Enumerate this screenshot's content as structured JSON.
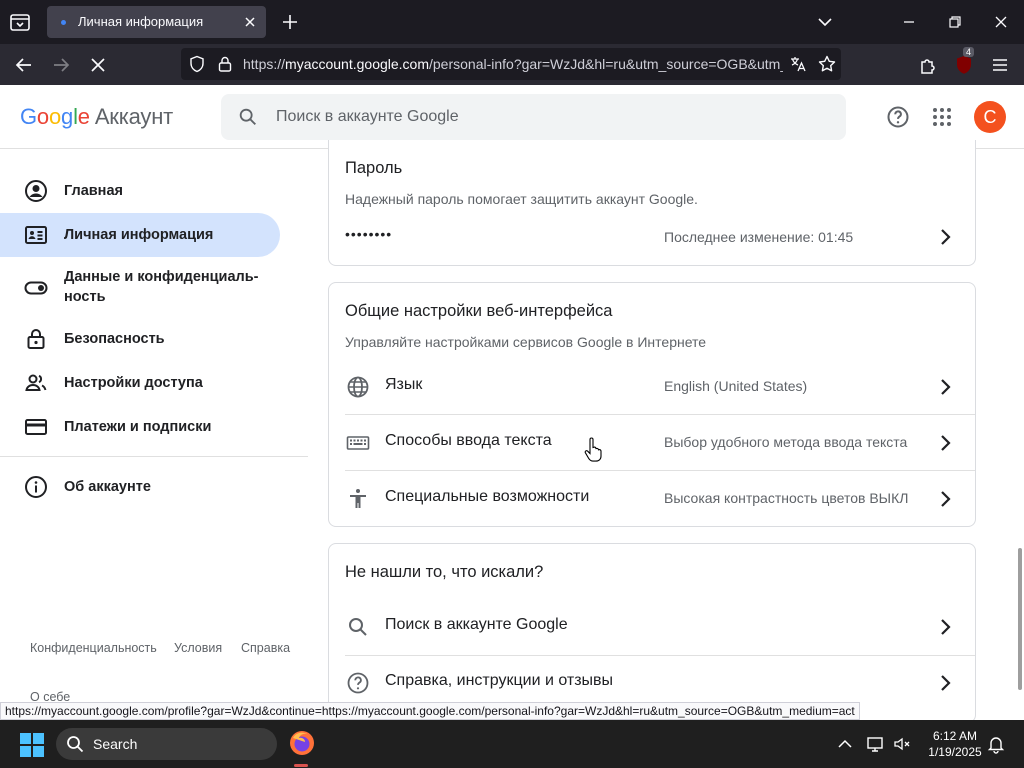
{
  "browser": {
    "tab_title": "Личная информация",
    "url_prefix": "https://",
    "url_host": "myaccount.google.com",
    "url_path": "/personal-info?gar=WzJd&hl=ru&utm_source=OGB&utm_medium=act",
    "extension_badge": "4",
    "status_url": "https://myaccount.google.com/profile?gar=WzJd&continue=https://myaccount.google.com/personal-info?gar=WzJd&hl=ru&utm_source=OGB&utm_medium=act"
  },
  "header": {
    "logo_text": "Google",
    "product": "Аккаунт",
    "search_placeholder": "Поиск в аккаунте Google",
    "avatar_letter": "С",
    "colors": {
      "blue": "#4285F4",
      "red": "#EA4335",
      "yellow": "#FBBC05",
      "green": "#34A853",
      "avatar": "#F4511E"
    }
  },
  "sidebar": {
    "items": [
      {
        "label": "Главная",
        "icon": "account-circle-icon"
      },
      {
        "label": "Личная информация",
        "icon": "id-card-icon",
        "active": true
      },
      {
        "label": "Данные и конфиденциаль-",
        "label2": "ность",
        "icon": "toggle-icon"
      },
      {
        "label": "Безопасность",
        "icon": "lock-icon"
      },
      {
        "label": "Настройки доступа",
        "icon": "people-icon"
      },
      {
        "label": "Платежи и подписки",
        "icon": "credit-card-icon"
      },
      {
        "label": "Об аккаунте",
        "icon": "info-icon"
      }
    ],
    "footer": {
      "privacy": "Конфиденциальность",
      "terms": "Условия",
      "help": "Справка",
      "about": "О себе"
    }
  },
  "password_card": {
    "title": "Пароль",
    "subtitle": "Надежный пароль помогает защитить аккаунт Google.",
    "masked": "••••••••",
    "last_changed": "Последнее изменение: 01:45"
  },
  "web_settings_card": {
    "title": "Общие настройки веб-интерфейса",
    "subtitle": "Управляйте настройками сервисов Google в Интернете",
    "rows": [
      {
        "label": "Язык",
        "value": "English (United States)",
        "icon": "globe-icon"
      },
      {
        "label": "Способы ввода текста",
        "value": "Выбор удобного метода ввода текста",
        "icon": "keyboard-icon"
      },
      {
        "label": "Специальные возможности",
        "value": "Высокая контрастность цветов ВЫКЛ",
        "icon": "accessibility-icon"
      }
    ]
  },
  "not_found_card": {
    "title": "Не нашли то, что искали?",
    "rows": [
      {
        "label": "Поиск в аккаунте Google",
        "icon": "search-icon"
      },
      {
        "label": "Справка, инструкции и отзывы",
        "icon": "help-icon"
      }
    ]
  },
  "taskbar": {
    "search_label": "Search",
    "time": "6:12 AM",
    "date": "1/19/2025"
  }
}
